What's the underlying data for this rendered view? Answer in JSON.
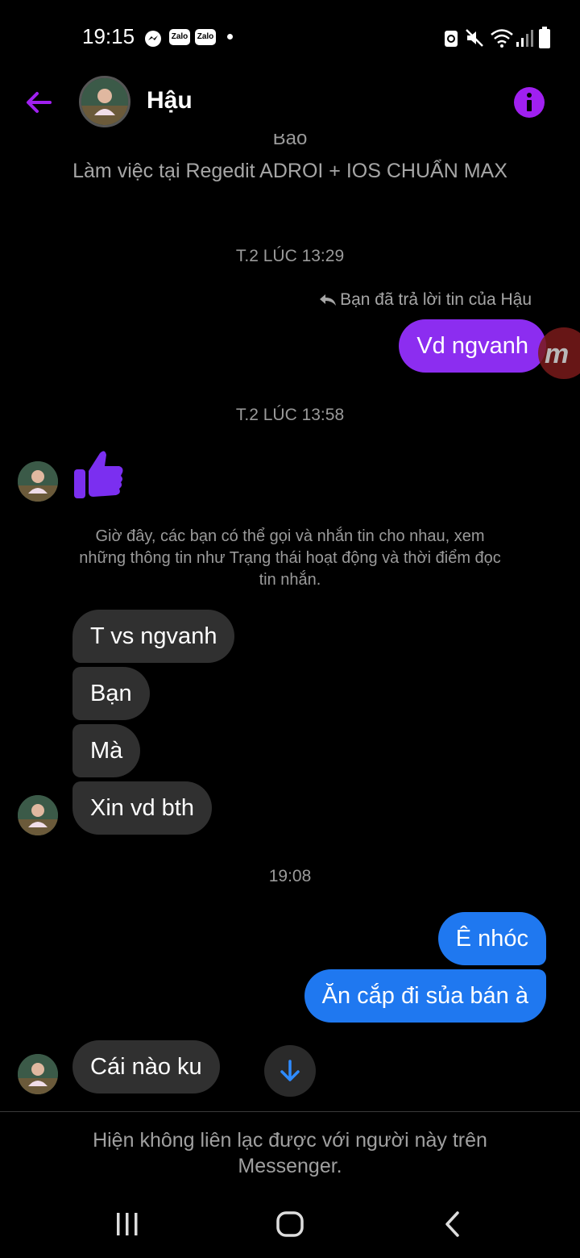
{
  "status_bar": {
    "time": "19:15",
    "zalo_label": "Zalo"
  },
  "header": {
    "contact_name": "Hậu"
  },
  "intro": {
    "cut_text": "Bảo",
    "bio": "Làm việc tại Regedit ADROI + IOS CHUẨN MAX"
  },
  "conversation": {
    "timestamp_1": "T.2 LÚC 13:29",
    "reply_label": "Bạn đã trả lời tin của Hậu",
    "msg_out_1": "Vd ngvanh",
    "timestamp_2": "T.2 LÚC 13:58",
    "notice": "Giờ đây, các bạn có thể gọi và nhắn tin cho nhau, xem những thông tin như Trạng thái hoạt động và thời điểm đọc tin nhắn.",
    "incoming_group": [
      "T vs ngvanh",
      "Bạn",
      "Mà",
      "Xin vd bth"
    ],
    "timestamp_3": "19:08",
    "msg_out_2": "Ê nhóc",
    "msg_out_3": "Ăn cắp đi sủa bán à",
    "msg_in_last": "Cái nào ku"
  },
  "footer": {
    "unreachable_line1": "Hiện không liên lạc được với người này trên",
    "unreachable_line2": "Messenger."
  },
  "colors": {
    "accent": "#a020f0",
    "purple_bubble": "#8c2df0",
    "blue_bubble": "#1f78f0",
    "incoming_bubble": "#303030",
    "thumb": "#7b2ff0"
  },
  "icons": [
    "messenger-icon",
    "zalo-icon",
    "alarm-icon",
    "mute-icon",
    "wifi-icon",
    "signal-icon",
    "battery-icon",
    "back-arrow-icon",
    "info-icon",
    "reply-icon",
    "thumbs-up-icon",
    "scroll-down-icon",
    "recent-apps-icon",
    "home-icon",
    "back-nav-icon"
  ]
}
